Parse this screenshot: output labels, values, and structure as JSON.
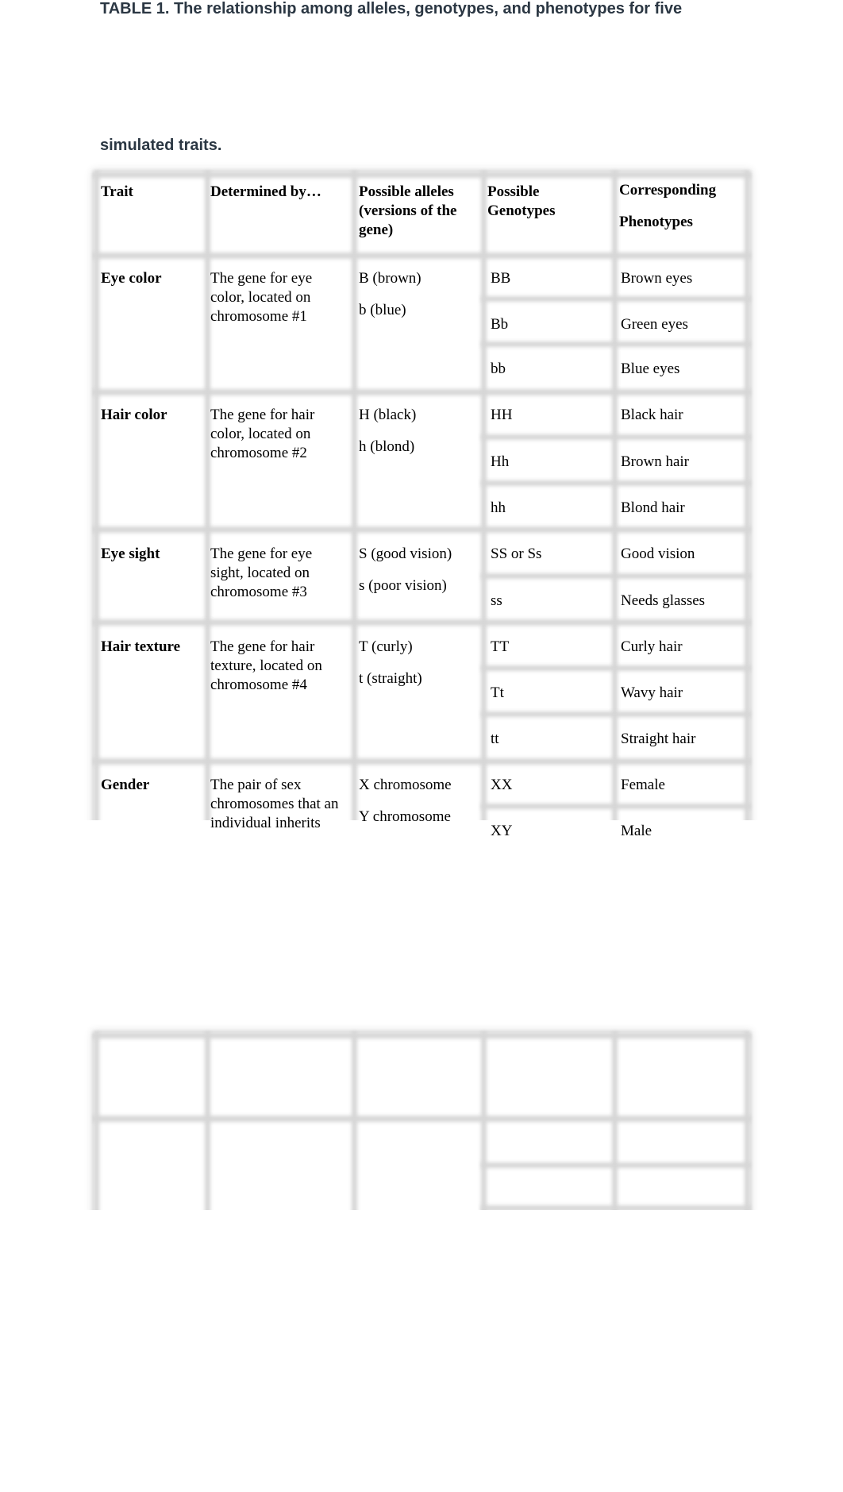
{
  "document": {
    "caption": {
      "line1": "TABLE 1. The relationship among alleles, genotypes, and phenotypes for five",
      "line2": "simulated traits."
    },
    "table": {
      "headers": {
        "trait": "Trait",
        "determined_by": "Determined by…",
        "alleles": "Possible alleles\n(versions of the\ngene)",
        "genotypes": " Possible\nGenotypes",
        "phenotypes": "Corresponding\n\nPhenotypes"
      },
      "rows": [
        {
          "trait": "Eye color",
          "determined_by": "The gene for eye\ncolor, located on\nchromosome #1",
          "alleles": [
            "B (brown)",
            "b (blue)"
          ],
          "genotypes": [
            "BB",
            "Bb",
            "bb"
          ],
          "phenotypes": [
            "Brown eyes",
            "Green eyes",
            "Blue eyes"
          ]
        },
        {
          "trait": "Hair color",
          "determined_by": "The gene for hair\ncolor, located on\nchromosome #2",
          "alleles": [
            "H (black)",
            "h (blond)"
          ],
          "genotypes": [
            "HH",
            "Hh",
            "hh"
          ],
          "phenotypes": [
            "Black hair",
            "Brown hair",
            "Blond hair"
          ]
        },
        {
          "trait": "Eye sight",
          "determined_by": "The gene for eye\nsight, located on\nchromosome #3",
          "alleles": [
            "S (good vision)",
            "s (poor vision)"
          ],
          "genotypes": [
            "SS or Ss",
            "ss"
          ],
          "phenotypes": [
            "Good vision",
            "Needs glasses"
          ]
        },
        {
          "trait": "Hair texture",
          "determined_by": "The gene for hair\ntexture, located on\nchromosome #4",
          "alleles": [
            "T (curly)",
            "t (straight)"
          ],
          "genotypes": [
            "TT",
            "Tt",
            "tt"
          ],
          "phenotypes": [
            "Curly hair",
            "Wavy hair",
            "Straight hair"
          ]
        },
        {
          "trait": "Gender",
          "determined_by": "The pair of sex\nchromosomes that an\nindividual inherits",
          "alleles": [
            "X chromosome",
            "Y chromosome"
          ],
          "genotypes": [
            "XX",
            "XY"
          ],
          "phenotypes": [
            "Female",
            "Male"
          ]
        }
      ]
    }
  }
}
